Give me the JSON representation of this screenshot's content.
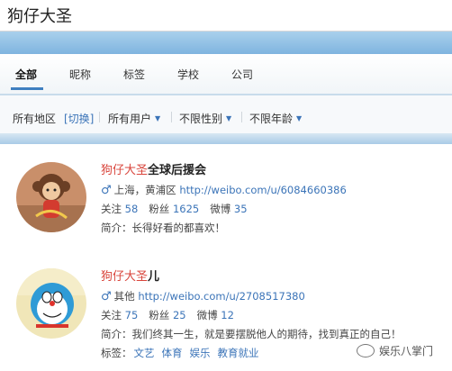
{
  "search": {
    "value": "狗仔大圣"
  },
  "tabs": [
    {
      "label": "全部",
      "active": true
    },
    {
      "label": "昵称"
    },
    {
      "label": "标签"
    },
    {
      "label": "学校"
    },
    {
      "label": "公司"
    }
  ],
  "filters": {
    "region": "所有地区",
    "switch": "[切换]",
    "users": "所有用户",
    "gender": "不限性别",
    "age": "不限年龄"
  },
  "results": [
    {
      "name_highlight": "狗仔大圣",
      "name_rest": "全球后援会",
      "location": "上海，黄浦区",
      "url": "http://weibo.com/u/6084660386",
      "following_label": "关注",
      "following": "58",
      "fans_label": "粉丝",
      "fans": "1625",
      "posts_label": "微博",
      "posts": "35",
      "bio_label": "简介：",
      "bio": "长得好看的都喜欢！"
    },
    {
      "name_highlight": "狗仔大圣",
      "name_rest": "儿",
      "location": "其他",
      "url": "http://weibo.com/u/2708517380",
      "following_label": "关注",
      "following": "75",
      "fans_label": "粉丝",
      "fans": "25",
      "posts_label": "微博",
      "posts": "12",
      "bio_label": "简介：",
      "bio": "我们终其一生，就是要摆脱他人的期待，找到真正的自己！",
      "tags_label": "标签：",
      "tags": [
        "文艺",
        "体育",
        "娱乐",
        "教育就业"
      ]
    }
  ],
  "watermark": {
    "text": "娱乐八掌门"
  },
  "colors": {
    "link": "#3b74b8",
    "highlight": "#d9453c",
    "band": "#7fb4df"
  }
}
